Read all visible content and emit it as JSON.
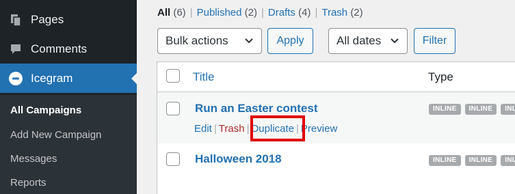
{
  "sidebar": {
    "menu": [
      {
        "label": "Pages",
        "icon": "pages-icon"
      },
      {
        "label": "Comments",
        "icon": "comments-icon"
      },
      {
        "label": "Icegram",
        "icon": "icegram-icon",
        "active": true
      }
    ],
    "submenu": [
      {
        "label": "All Campaigns",
        "current": true
      },
      {
        "label": "Add New Campaign"
      },
      {
        "label": "Messages"
      },
      {
        "label": "Reports"
      }
    ]
  },
  "views": {
    "all": {
      "label": "All",
      "count": "(6)"
    },
    "published": {
      "label": "Published",
      "count": "(2)"
    },
    "drafts": {
      "label": "Drafts",
      "count": "(4)"
    },
    "trash": {
      "label": "Trash",
      "count": "(2)"
    },
    "separator": "|"
  },
  "toolbar": {
    "bulk_actions": "Bulk actions",
    "apply": "Apply",
    "dates": "All dates",
    "filter": "Filter"
  },
  "table": {
    "columns": {
      "title": "Title",
      "type": "Type"
    },
    "rows": [
      {
        "title": "Run an Easter contest",
        "actions": {
          "edit": "Edit",
          "trash": "Trash",
          "duplicate": "Duplicate",
          "preview": "Preview"
        },
        "badges": [
          "INLINE",
          "INLINE",
          "INLINE"
        ]
      },
      {
        "title": "Halloween 2018",
        "badges": [
          "INLINE",
          "INLINE",
          "INLINE"
        ]
      }
    ]
  },
  "colors": {
    "sidebar_bg": "#1d2327",
    "accent": "#2271b1",
    "trash": "#b32d2e",
    "highlight_box": "#e20000",
    "badge_bg": "#a7aaad"
  }
}
